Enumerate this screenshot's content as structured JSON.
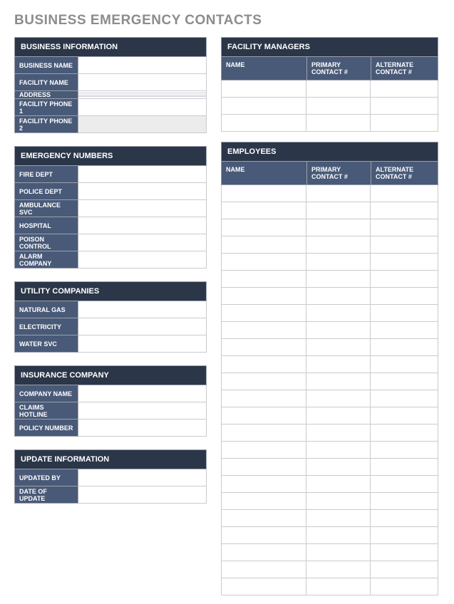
{
  "title": "BUSINESS EMERGENCY CONTACTS",
  "sections": {
    "business_info": {
      "header": "BUSINESS INFORMATION",
      "fields": {
        "business_name": {
          "label": "BUSINESS NAME",
          "value": ""
        },
        "facility_name": {
          "label": "FACILITY NAME",
          "value": ""
        },
        "address": {
          "label": "ADDRESS",
          "lines": [
            "",
            "",
            "",
            ""
          ]
        },
        "facility_phone_1": {
          "label": "FACILITY PHONE 1",
          "value": ""
        },
        "facility_phone_2": {
          "label": "FACILITY PHONE 2",
          "value": ""
        }
      }
    },
    "emergency_numbers": {
      "header": "EMERGENCY NUMBERS",
      "fields": {
        "fire_dept": {
          "label": "FIRE DEPT",
          "value": ""
        },
        "police_dept": {
          "label": "POLICE DEPT",
          "value": ""
        },
        "ambulance_svc": {
          "label": "AMBULANCE SVC",
          "value": ""
        },
        "hospital": {
          "label": "HOSPITAL",
          "value": ""
        },
        "poison_control": {
          "label": "POISON CONTROL",
          "value": ""
        },
        "alarm_company": {
          "label": "ALARM COMPANY",
          "value": ""
        }
      }
    },
    "utility_companies": {
      "header": "UTILITY COMPANIES",
      "fields": {
        "natural_gas": {
          "label": "NATURAL GAS",
          "value": ""
        },
        "electricity": {
          "label": "ELECTRICITY",
          "value": ""
        },
        "water_svc": {
          "label": "WATER SVC",
          "value": ""
        }
      }
    },
    "insurance_company": {
      "header": "INSURANCE COMPANY",
      "fields": {
        "company_name": {
          "label": "COMPANY NAME",
          "value": ""
        },
        "claims_hotline": {
          "label": "CLAIMS HOTLINE",
          "value": ""
        },
        "policy_number": {
          "label": "POLICY NUMBER",
          "value": ""
        }
      }
    },
    "update_information": {
      "header": "UPDATE INFORMATION",
      "fields": {
        "updated_by": {
          "label": "UPDATED BY",
          "value": ""
        },
        "date_of_update": {
          "label": "DATE OF UPDATE",
          "value": ""
        }
      }
    },
    "facility_managers": {
      "header": "FACILITY MANAGERS",
      "columns": {
        "name": "NAME",
        "primary": "PRIMARY CONTACT #",
        "alternate": "ALTERNATE CONTACT #"
      },
      "rows": [
        {
          "name": "",
          "primary": "",
          "alternate": ""
        },
        {
          "name": "",
          "primary": "",
          "alternate": ""
        },
        {
          "name": "",
          "primary": "",
          "alternate": ""
        }
      ]
    },
    "employees": {
      "header": "EMPLOYEES",
      "columns": {
        "name": "NAME",
        "primary": "PRIMARY CONTACT #",
        "alternate": "ALTERNATE CONTACT #"
      },
      "row_count": 24
    }
  }
}
